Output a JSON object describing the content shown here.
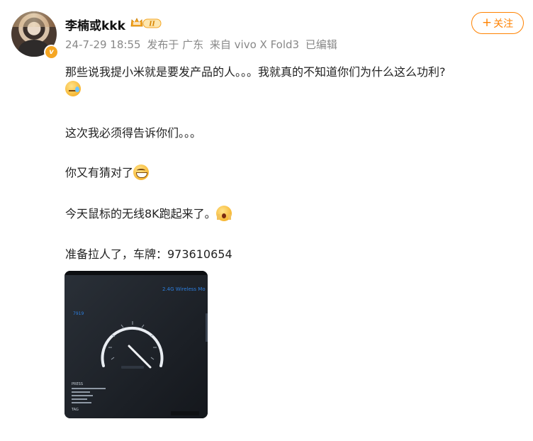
{
  "post": {
    "username": "李楠或kkk",
    "verified_badge": "v",
    "member_level": "II",
    "meta": {
      "datetime": "24-7-29 18:55",
      "posted_in": "发布于 广东",
      "device": "来自 vivo X Fold3",
      "edited": "已编辑"
    },
    "follow_label": "关注",
    "paragraphs": [
      "那些说我提小米就是要发产品的人。。。我就真的不知道你们为什么这么功利?",
      "这次我必须得告诉你们。。。",
      "你又有猜对了",
      "今天鼠标的无线8K跑起来了。",
      "准备拉人了，车牌：973610654"
    ],
    "emojis": [
      "sweat-emoji",
      "grin-emoji",
      "shocked-emoji"
    ],
    "photo": {
      "screen_title": "2.4G Wireless Mo",
      "left_value": "7919",
      "gauge_readout": "",
      "menu_title": "PRESS",
      "footer_label": "TAG"
    }
  },
  "colors": {
    "accent": "#ff8200",
    "meta_gray": "#888888",
    "screen_blue": "#2d7fe0"
  }
}
